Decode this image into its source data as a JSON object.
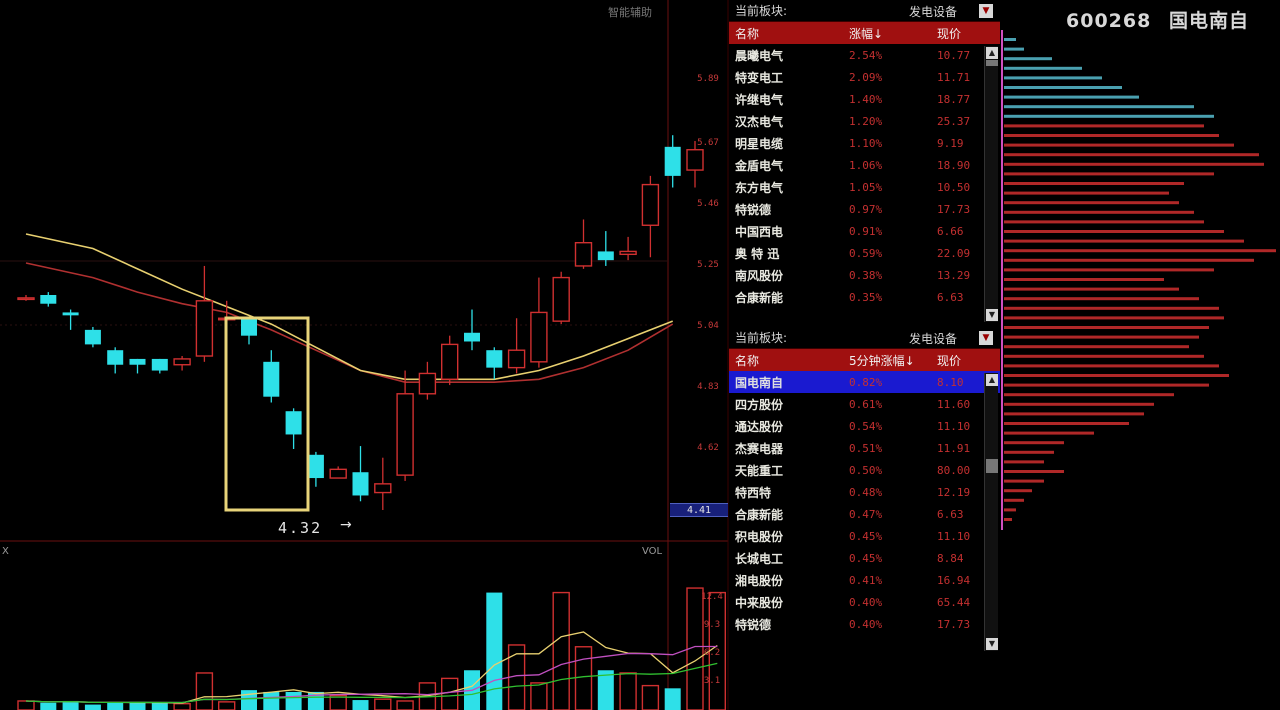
{
  "header": {
    "chart_title": "智能辅助",
    "stock_code": "600268",
    "stock_name": "国电南自",
    "stock_title": "600268 国电南自"
  },
  "chart": {
    "low_label": "4.32",
    "low_arrow": "→",
    "volume_label": "VOL",
    "sub_label": "X",
    "current_price": "4.41",
    "price_axis": [
      "5.89",
      "5.67",
      "5.46",
      "5.25",
      "5.04",
      "4.83",
      "4.62",
      "4.41"
    ],
    "volume_axis": [
      "12.4",
      "9.3",
      "6.2",
      "3.1"
    ]
  },
  "panel1": {
    "title": "当前板块:",
    "sector": "发电设备",
    "dropdown": "▼",
    "columns": [
      "名称",
      "涨幅↓",
      "现价"
    ],
    "rows": [
      {
        "name": "晨曦电气",
        "change": "2.54%",
        "price": "10.77"
      },
      {
        "name": "特变电工",
        "change": "2.09%",
        "price": "11.71"
      },
      {
        "name": "许继电气",
        "change": "1.40%",
        "price": "18.77"
      },
      {
        "name": "汉杰电气",
        "change": "1.20%",
        "price": "25.37"
      },
      {
        "name": "明星电缆",
        "change": "1.10%",
        "price": "9.19"
      },
      {
        "name": "金盾电气",
        "change": "1.06%",
        "price": "18.90"
      },
      {
        "name": "东方电气",
        "change": "1.05%",
        "price": "10.50"
      },
      {
        "name": "特锐德",
        "change": "0.97%",
        "price": "17.73"
      },
      {
        "name": "中国西电",
        "change": "0.91%",
        "price": "6.66"
      },
      {
        "name": "奥 特 迅",
        "change": "0.59%",
        "price": "22.09"
      },
      {
        "name": "南风股份",
        "change": "0.38%",
        "price": "13.29"
      },
      {
        "name": "合康新能",
        "change": "0.35%",
        "price": "6.63"
      }
    ]
  },
  "panel2": {
    "title": "当前板块:",
    "sector": "发电设备",
    "dropdown": "▼",
    "columns": [
      "名称",
      "5分钟涨幅↓",
      "现价"
    ],
    "rows": [
      {
        "name": "国电南自",
        "change": "0.82%",
        "price": "8.10"
      },
      {
        "name": "四方股份",
        "change": "0.61%",
        "price": "11.60"
      },
      {
        "name": "通达股份",
        "change": "0.54%",
        "price": "11.10"
      },
      {
        "name": "杰赛电器",
        "change": "0.51%",
        "price": "11.91"
      },
      {
        "name": "天能重工",
        "change": "0.50%",
        "price": "80.00"
      },
      {
        "name": "特西特",
        "change": "0.48%",
        "price": "12.19"
      },
      {
        "name": "合康新能",
        "change": "0.47%",
        "price": "6.63"
      },
      {
        "name": "积电股份",
        "change": "0.45%",
        "price": "11.10"
      },
      {
        "name": "长城电工",
        "change": "0.45%",
        "price": "8.84"
      },
      {
        "name": "湘电股份",
        "change": "0.41%",
        "price": "16.94"
      },
      {
        "name": "中来股份",
        "change": "0.40%",
        "price": "65.44"
      },
      {
        "name": "特锐德",
        "change": "0.40%",
        "price": "17.73"
      }
    ]
  },
  "colors": {
    "up": "#d03030",
    "down": "#2ee0e8",
    "ma_yellow": "#e8d070",
    "ma_red": "#b03030",
    "highlight_box": "#e8d47a",
    "header_bar": "#a01010",
    "selected_row": "#1a1ad0"
  },
  "candles": [
    {
      "o": 5.14,
      "c": 5.14,
      "h": 5.15,
      "l": 5.13
    },
    {
      "o": 5.15,
      "c": 5.12,
      "h": 5.16,
      "l": 5.11
    },
    {
      "o": 5.09,
      "c": 5.08,
      "h": 5.1,
      "l": 5.03
    },
    {
      "o": 5.03,
      "c": 4.98,
      "h": 5.04,
      "l": 4.97
    },
    {
      "o": 4.96,
      "c": 4.91,
      "h": 4.97,
      "l": 4.88
    },
    {
      "o": 4.93,
      "c": 4.91,
      "h": 4.93,
      "l": 4.88
    },
    {
      "o": 4.93,
      "c": 4.89,
      "h": 4.93,
      "l": 4.88
    },
    {
      "o": 4.91,
      "c": 4.93,
      "h": 4.94,
      "l": 4.89
    },
    {
      "o": 4.94,
      "c": 5.13,
      "h": 5.25,
      "l": 4.92
    },
    {
      "o": 5.07,
      "c": 5.07,
      "h": 5.13,
      "l": 5.05
    },
    {
      "o": 5.07,
      "c": 5.01,
      "h": 5.07,
      "l": 4.98
    },
    {
      "o": 4.92,
      "c": 4.8,
      "h": 4.96,
      "l": 4.78
    },
    {
      "o": 4.75,
      "c": 4.67,
      "h": 4.76,
      "l": 4.62
    },
    {
      "o": 4.6,
      "c": 4.52,
      "h": 4.61,
      "l": 4.49
    },
    {
      "o": 4.52,
      "c": 4.55,
      "h": 4.56,
      "l": 4.52
    },
    {
      "o": 4.54,
      "c": 4.46,
      "h": 4.63,
      "l": 4.44
    },
    {
      "o": 4.47,
      "c": 4.5,
      "h": 4.59,
      "l": 4.41
    },
    {
      "o": 4.53,
      "c": 4.81,
      "h": 4.89,
      "l": 4.51
    },
    {
      "o": 4.81,
      "c": 4.88,
      "h": 4.92,
      "l": 4.79
    },
    {
      "o": 4.86,
      "c": 4.98,
      "h": 5.01,
      "l": 4.84
    },
    {
      "o": 5.02,
      "c": 4.99,
      "h": 5.1,
      "l": 4.96
    },
    {
      "o": 4.96,
      "c": 4.9,
      "h": 4.97,
      "l": 4.86
    },
    {
      "o": 4.9,
      "c": 4.96,
      "h": 5.07,
      "l": 4.88
    },
    {
      "o": 4.92,
      "c": 5.09,
      "h": 5.21,
      "l": 4.9
    },
    {
      "o": 5.06,
      "c": 5.21,
      "h": 5.23,
      "l": 5.05
    },
    {
      "o": 5.25,
      "c": 5.33,
      "h": 5.41,
      "l": 5.24
    },
    {
      "o": 5.3,
      "c": 5.27,
      "h": 5.37,
      "l": 5.25
    },
    {
      "o": 5.29,
      "c": 5.3,
      "h": 5.35,
      "l": 5.27
    },
    {
      "o": 5.39,
      "c": 5.53,
      "h": 5.56,
      "l": 5.28
    },
    {
      "o": 5.66,
      "c": 5.56,
      "h": 5.7,
      "l": 5.52
    },
    {
      "o": 5.58,
      "c": 5.65,
      "h": 5.68,
      "l": 5.52
    }
  ],
  "volumes": [
    1.0,
    0.8,
    1.0,
    0.6,
    0.8,
    0.9,
    0.8,
    0.7,
    4.1,
    0.9,
    2.2,
    2.0,
    2.0,
    2.0,
    1.6,
    1.1,
    1.2,
    1.0,
    3.0,
    3.5,
    4.4,
    13.0,
    7.2,
    3.0,
    13.0,
    7.0,
    4.4,
    4.1,
    2.7,
    2.4,
    13.5,
    13.0
  ],
  "ma1": [
    [
      0,
      5.36
    ],
    [
      3,
      5.31
    ],
    [
      5,
      5.24
    ],
    [
      7,
      5.17
    ],
    [
      9,
      5.11
    ],
    [
      11,
      5.05
    ],
    [
      13,
      4.97
    ],
    [
      15,
      4.89
    ],
    [
      17,
      4.86
    ],
    [
      19,
      4.86
    ],
    [
      21,
      4.86
    ],
    [
      23,
      4.89
    ],
    [
      25,
      4.94
    ],
    [
      27,
      5.0
    ],
    [
      29,
      5.06
    ]
  ],
  "ma2": [
    [
      0,
      5.26
    ],
    [
      3,
      5.21
    ],
    [
      5,
      5.16
    ],
    [
      7,
      5.12
    ],
    [
      9,
      5.09
    ],
    [
      11,
      5.03
    ],
    [
      13,
      4.96
    ],
    [
      15,
      4.89
    ],
    [
      17,
      4.85
    ],
    [
      19,
      4.85
    ],
    [
      21,
      4.85
    ],
    [
      23,
      4.86
    ],
    [
      25,
      4.9
    ],
    [
      27,
      4.96
    ],
    [
      29,
      5.05
    ]
  ],
  "volume_profile": [
    {
      "len": 12,
      "c": "#4aa0b0"
    },
    {
      "len": 20,
      "c": "#4aa0b0"
    },
    {
      "len": 48,
      "c": "#4aa0b0"
    },
    {
      "len": 78,
      "c": "#4aa0b0"
    },
    {
      "len": 98,
      "c": "#4aa0b0"
    },
    {
      "len": 118,
      "c": "#4aa0b0"
    },
    {
      "len": 135,
      "c": "#4aa0b0"
    },
    {
      "len": 190,
      "c": "#4aa0b0"
    },
    {
      "len": 210,
      "c": "#4aa0b0"
    },
    {
      "len": 200,
      "c": "#b02828"
    },
    {
      "len": 215,
      "c": "#b02828"
    },
    {
      "len": 230,
      "c": "#b02828"
    },
    {
      "len": 255,
      "c": "#b02828"
    },
    {
      "len": 260,
      "c": "#b02828"
    },
    {
      "len": 210,
      "c": "#b02828"
    },
    {
      "len": 180,
      "c": "#b02828"
    },
    {
      "len": 165,
      "c": "#b02828"
    },
    {
      "len": 175,
      "c": "#b02828"
    },
    {
      "len": 190,
      "c": "#b02828"
    },
    {
      "len": 200,
      "c": "#b02828"
    },
    {
      "len": 220,
      "c": "#b02828"
    },
    {
      "len": 240,
      "c": "#b02828"
    },
    {
      "len": 272,
      "c": "#b02828"
    },
    {
      "len": 250,
      "c": "#b02828"
    },
    {
      "len": 210,
      "c": "#b02828"
    },
    {
      "len": 160,
      "c": "#b02828"
    },
    {
      "len": 175,
      "c": "#b02828"
    },
    {
      "len": 195,
      "c": "#b02828"
    },
    {
      "len": 215,
      "c": "#b02828"
    },
    {
      "len": 220,
      "c": "#b02828"
    },
    {
      "len": 205,
      "c": "#b02828"
    },
    {
      "len": 195,
      "c": "#b02828"
    },
    {
      "len": 185,
      "c": "#b02828"
    },
    {
      "len": 200,
      "c": "#b02828"
    },
    {
      "len": 215,
      "c": "#b02828"
    },
    {
      "len": 225,
      "c": "#b02828"
    },
    {
      "len": 205,
      "c": "#b02828"
    },
    {
      "len": 170,
      "c": "#b02828"
    },
    {
      "len": 150,
      "c": "#b02828"
    },
    {
      "len": 140,
      "c": "#b02828"
    },
    {
      "len": 125,
      "c": "#b02828"
    },
    {
      "len": 90,
      "c": "#b02828"
    },
    {
      "len": 60,
      "c": "#b02828"
    },
    {
      "len": 50,
      "c": "#b02828"
    },
    {
      "len": 40,
      "c": "#b02828"
    },
    {
      "len": 60,
      "c": "#b02828"
    },
    {
      "len": 40,
      "c": "#b02828"
    },
    {
      "len": 28,
      "c": "#b02828"
    },
    {
      "len": 20,
      "c": "#b02828"
    },
    {
      "len": 12,
      "c": "#b02828"
    },
    {
      "len": 8,
      "c": "#b02828"
    }
  ]
}
